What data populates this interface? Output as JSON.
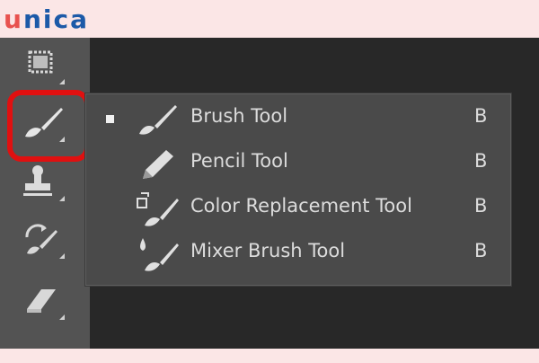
{
  "logo": {
    "first_letter": "u",
    "rest": "nica"
  },
  "toolbar": {
    "tools": [
      {
        "name": "artboard-icon"
      },
      {
        "name": "brush-icon",
        "selected": true
      },
      {
        "name": "clone-stamp-icon"
      },
      {
        "name": "history-brush-icon"
      },
      {
        "name": "eraser-icon"
      }
    ]
  },
  "flyout": {
    "items": [
      {
        "label": "Brush Tool",
        "shortcut": "B",
        "icon": "brush-icon",
        "active": true
      },
      {
        "label": "Pencil Tool",
        "shortcut": "B",
        "icon": "pencil-icon",
        "active": false
      },
      {
        "label": "Color Replacement Tool",
        "shortcut": "B",
        "icon": "color-replacement-icon",
        "active": false
      },
      {
        "label": "Mixer Brush Tool",
        "shortcut": "B",
        "icon": "mixer-brush-icon",
        "active": false
      }
    ]
  },
  "colors": {
    "highlight": "#e01010",
    "panel": "#4a4a4a",
    "toolbar": "#535353",
    "canvas": "#282828"
  }
}
